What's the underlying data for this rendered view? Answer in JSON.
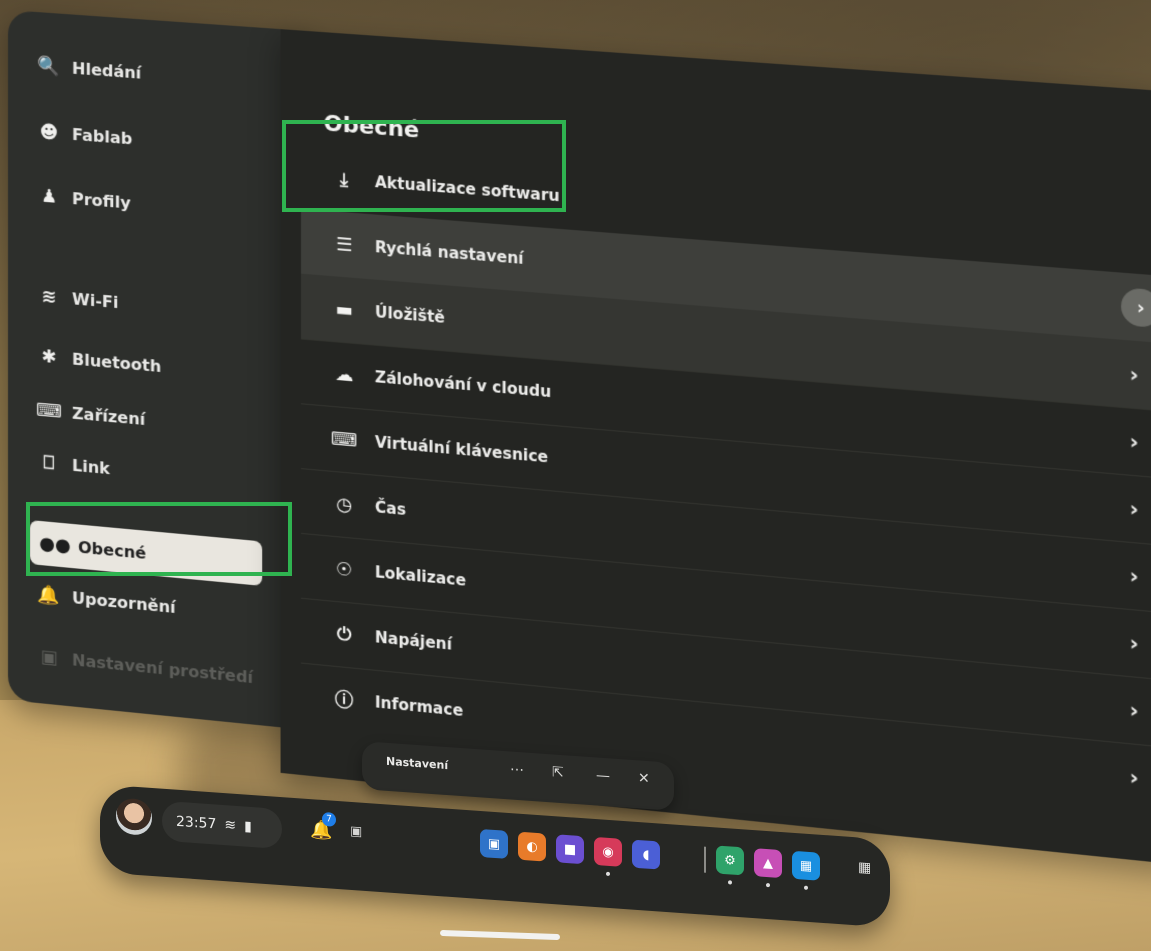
{
  "sidebar": {
    "search": "Hledání",
    "user": "Fablab",
    "profiles": "Profily",
    "wifi": "Wi-Fi",
    "bluetooth": "Bluetooth",
    "devices": "Zařízení",
    "link": "Link",
    "general": "Obecné",
    "notifications": "Upozornění",
    "environment": "Nastavení prostředí"
  },
  "main": {
    "title": "Obecné",
    "rows": [
      {
        "label": "Aktualizace softwaru",
        "icon": "download-icon"
      },
      {
        "label": "Rychlá nastavení",
        "icon": "sliders-icon"
      },
      {
        "label": "Úložiště",
        "icon": "storage-icon"
      },
      {
        "label": "Zálohování v cloudu",
        "icon": "cloud-backup-icon"
      },
      {
        "label": "Virtuální klávesnice",
        "icon": "keyboard-icon"
      },
      {
        "label": "Čas",
        "icon": "clock-icon"
      },
      {
        "label": "Lokalizace",
        "icon": "globe-icon"
      },
      {
        "label": "Napájení",
        "icon": "power-icon"
      },
      {
        "label": "Informace",
        "icon": "info-icon"
      }
    ]
  },
  "titlebar": {
    "title": "Nastavení"
  },
  "dock": {
    "time": "23:57",
    "notification_count": "7"
  },
  "colors": {
    "highlight_box": "#2fb350",
    "panel": "#242522",
    "active_item": "#e9e6df"
  }
}
